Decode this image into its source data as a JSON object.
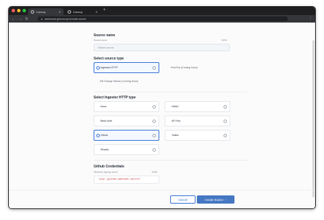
{
  "browser": {
    "tabs": [
      {
        "title": "Convoy",
        "active": true
      },
      {
        "title": "Convoy",
        "active": false
      }
    ],
    "url": "dashboard.getconvoy.io/create-source",
    "traffic_lights": [
      "#ff5f57",
      "#febc2e",
      "#28c840"
    ]
  },
  "form": {
    "source_name": {
      "title": "Source name",
      "label": "Source name",
      "counter": "00/00",
      "placeholder": "Github source"
    },
    "source_type": {
      "title": "Select source type",
      "options": [
        {
          "label": "Ingestion HTTP",
          "selected": true
        },
        {
          "label": "Pub/Sub (Coming Soon)",
          "selected": false
        },
        {
          "label": "DB Change Stream (Coming Soon)",
          "selected": false
        }
      ]
    },
    "ingester_type": {
      "title": "Select Ingester HTTP type",
      "options": [
        {
          "label": "None",
          "selected": false
        },
        {
          "label": "HMAC",
          "selected": false
        },
        {
          "label": "Basic Auth",
          "selected": false
        },
        {
          "label": "API Key",
          "selected": false
        },
        {
          "label": "Github",
          "selected": true
        },
        {
          "label": "Twitter",
          "selected": false
        },
        {
          "label": "Shopify",
          "selected": false
        }
      ]
    },
    "credentials": {
      "title": "Github Credentials",
      "label": "Webhook signing secret",
      "counter": "00/00",
      "value": "'your-github-webhook-secret'"
    },
    "actions": {
      "cancel": "Cancel",
      "create": "Create Source",
      "create_icon": "chevron-right-icon"
    }
  },
  "colors": {
    "accent": "#2e6dd6",
    "primary_button": "#4577c2",
    "secret_text": "#c2323a"
  }
}
